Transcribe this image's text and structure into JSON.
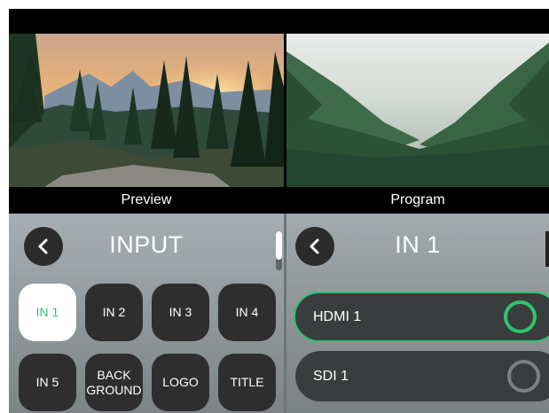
{
  "preview": {
    "label": "Preview"
  },
  "program": {
    "label": "Program"
  },
  "input_panel": {
    "title": "INPUT",
    "sources": [
      {
        "label": "IN 1",
        "active": true
      },
      {
        "label": "IN 2",
        "active": false
      },
      {
        "label": "IN 3",
        "active": false
      },
      {
        "label": "IN 4",
        "active": false
      },
      {
        "label": "IN 5",
        "active": false
      },
      {
        "label": "BACK\nGROUND",
        "active": false
      },
      {
        "label": "LOGO",
        "active": false
      },
      {
        "label": "TITLE",
        "active": false
      }
    ]
  },
  "in1_panel": {
    "title": "IN 1",
    "options": [
      {
        "label": "HDMI 1",
        "selected": true
      },
      {
        "label": "SDI 1",
        "selected": false
      }
    ]
  },
  "colors": {
    "accent": "#2fc46f",
    "button": "#2e2e2e",
    "background": "#000000"
  },
  "icons": {
    "back": "chevron-left-icon"
  }
}
